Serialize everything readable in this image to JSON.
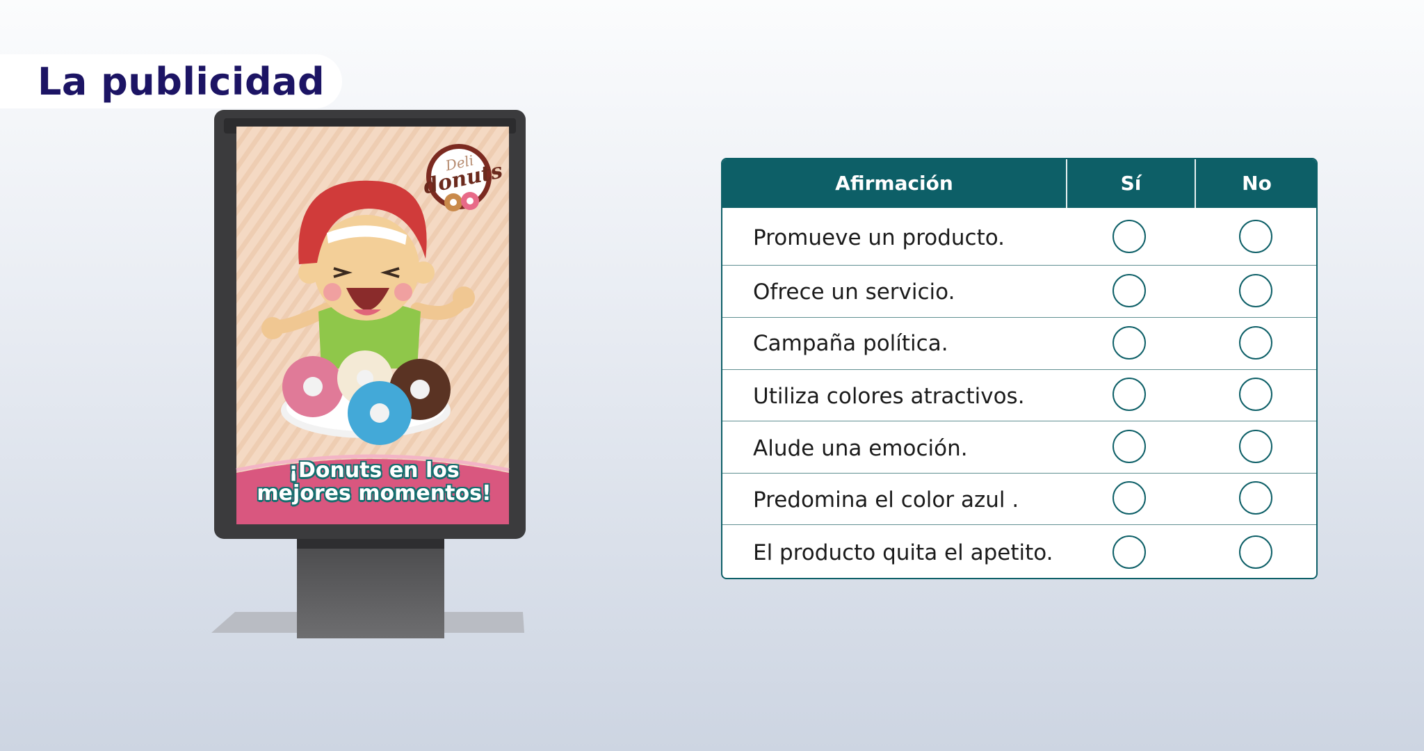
{
  "page": {
    "title": "La publicidad"
  },
  "poster": {
    "logo_line1": "Deli",
    "logo_line2": "donuts",
    "slogan_line1": "¡Donuts en los",
    "slogan_line2": "mejores momentos!"
  },
  "table": {
    "headers": [
      "Afirmación",
      "Sí",
      "No"
    ],
    "rows": [
      {
        "statement": "Promueve un producto."
      },
      {
        "statement": "Ofrece un servicio."
      },
      {
        "statement": "Campaña política."
      },
      {
        "statement": "Utiliza colores atractivos."
      },
      {
        "statement": "Alude una emoción."
      },
      {
        "statement": "Predomina el color azul ."
      },
      {
        "statement": "El producto quita el apetito."
      }
    ]
  },
  "colors": {
    "header_teal": "#0d5f67",
    "title_navy": "#1c1464",
    "poster_pink": "#d9577f"
  }
}
